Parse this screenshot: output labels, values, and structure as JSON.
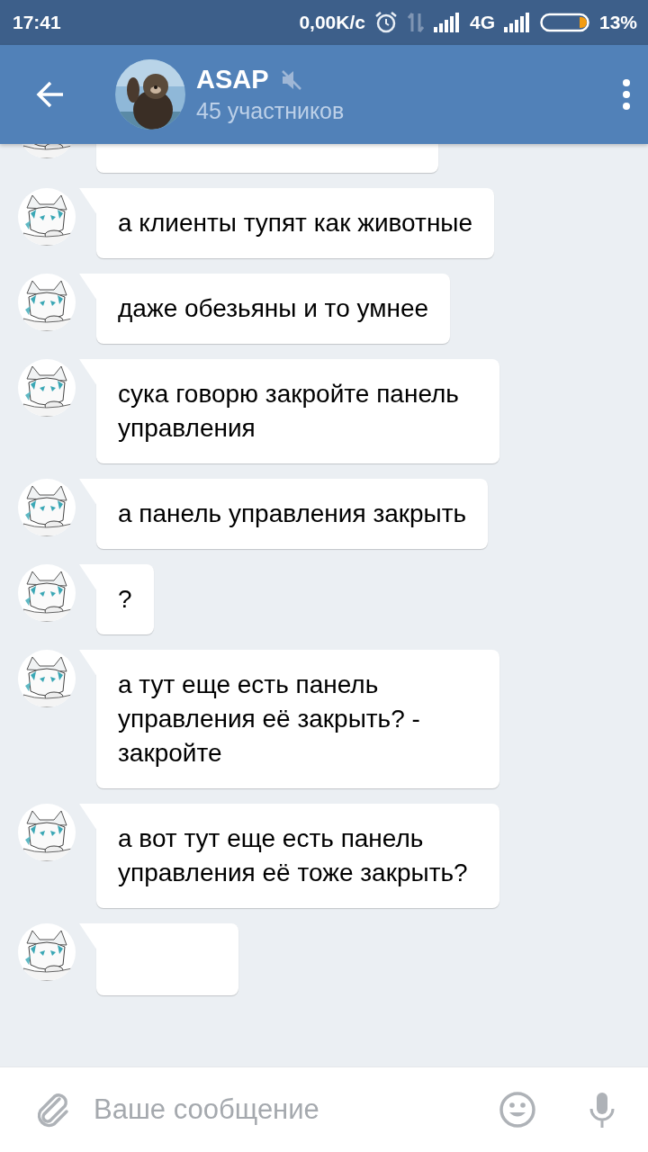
{
  "status_bar": {
    "time": "17:41",
    "network_speed": "0,00K/c",
    "network_type": "4G",
    "battery": "13%"
  },
  "header": {
    "title": "ASAP",
    "subtitle": "45 участников",
    "muted": true
  },
  "messages": [
    {
      "text": "а клиенты тупят как животные"
    },
    {
      "text": "даже обезьяны и то умнее"
    },
    {
      "text": "сука говорю закройте панель управления"
    },
    {
      "text": "а панель управления закрыть"
    },
    {
      "text": "?"
    },
    {
      "text": "а тут еще есть панель управления её закрыть? - закройте"
    },
    {
      "text": "а вот тут еще есть панель управления её тоже закрыть?"
    }
  ],
  "composer": {
    "placeholder": "Ваше сообщение"
  }
}
